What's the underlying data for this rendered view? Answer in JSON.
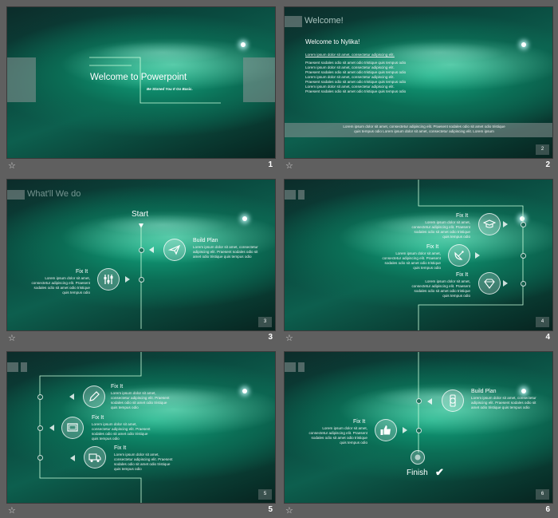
{
  "lorem_short": "Lorem ipsum dolor sit amet, consectetur adipiscing elit. Praesent sodales odio sit amet odio tristique quis tempus odio",
  "slides": [
    {
      "num": "1",
      "title": "Welcome to Powerpoint",
      "subtitle": "Be Stoned You It Go Basic."
    },
    {
      "num": "2",
      "page": "2",
      "header": "Welcome!",
      "title": "Welcome to Nylika!",
      "intro": "Lorem ipsum dolor sit amet, consectetur adipiscing elit.",
      "body": "Praesent sodales odio sit amet odio tristique quis tempus odio Lorem ipsum dolor sit amet, consectetur adipiscing elit. Praesent sodales odio sit amet odio tristique quis tempus odio Lorem ipsum dolor sit amet, consectetur adipiscing elit. Praesent sodales odio sit amet odio tristique quis tempus odio Lorem ipsum dolor sit amet, consectetur adipiscing elit. Praesent sodales odio sit amet odio tristique quis tempus odio",
      "banner": "Lorem ipsum dolor sit amet, consectetur adipiscing elit. Praesent sodales odio sit amet odio tristique quis tempus odio Lorem ipsum dolor sit amet, consectetur adipiscing elit. Lorem ipsum"
    },
    {
      "num": "3",
      "page": "3",
      "header": "What'll We do",
      "start": "Start",
      "build_plan": "Build Plan",
      "fix_it": "Fix It"
    },
    {
      "num": "4",
      "page": "4",
      "fix_a": "Fix It",
      "fix_b": "Fix It",
      "fix_c": "Fix It"
    },
    {
      "num": "5",
      "page": "5",
      "fix_a": "Fix It",
      "fix_b": "Fix It",
      "fix_c": "Fix It"
    },
    {
      "num": "6",
      "page": "6",
      "build_plan": "Build Plan",
      "fix_it": "Fix It",
      "finish": "Finish"
    }
  ],
  "icons": {
    "favorite": "star-outline-icon",
    "s3_build": "paper-plane-icon",
    "s3_fix": "sliders-icon",
    "s4_a": "graduation-cap-icon",
    "s4_b": "satellite-dish-icon",
    "s4_c": "diamond-icon",
    "s5_a": "pencil-icon",
    "s5_b": "monitor-icon",
    "s5_c": "truck-icon",
    "s6_build": "watch-icon",
    "s6_fix": "thumbs-up-icon",
    "s6_finish": "checkmark-icon"
  }
}
